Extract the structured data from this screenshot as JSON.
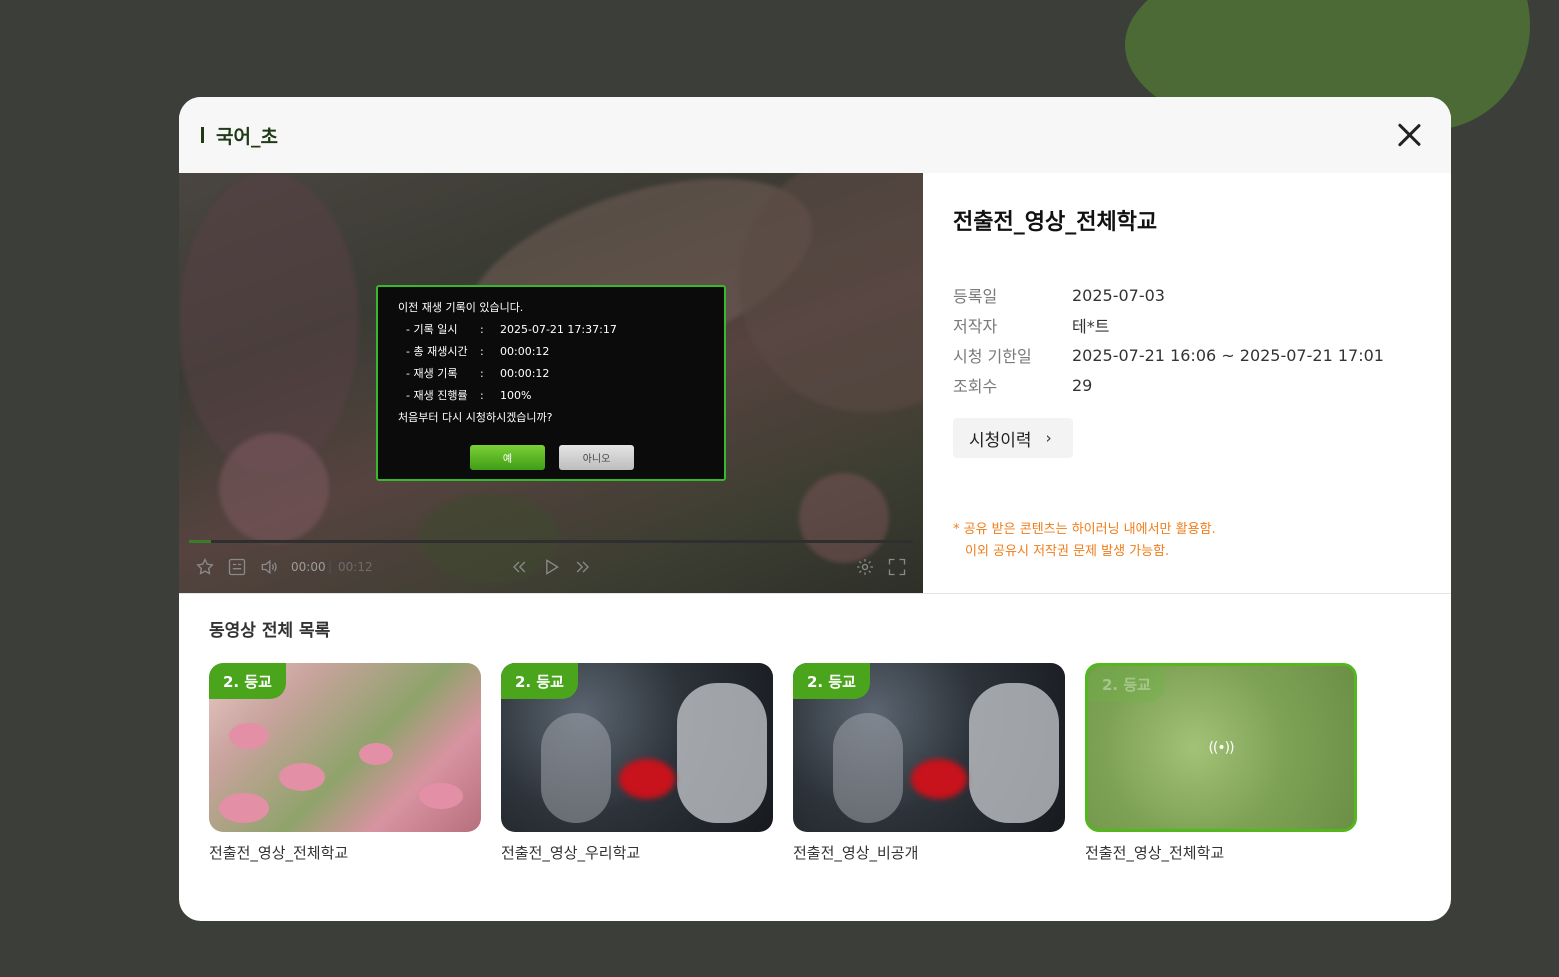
{
  "header": {
    "title": "국어_초"
  },
  "dialog": {
    "heading": "이전 재생 기록이 있습니다.",
    "rows": [
      {
        "label": "- 기록 일시",
        "value": "2025-07-21 17:37:17"
      },
      {
        "label": "- 총 재생시간",
        "value": "00:00:12"
      },
      {
        "label": "- 재생 기록",
        "value": "00:00:12"
      },
      {
        "label": "- 재생 진행률",
        "value": "100%"
      }
    ],
    "question": "처음부터 다시 시청하시겠습니까?",
    "yes_label": "예",
    "no_label": "아니오"
  },
  "player": {
    "current_time": "00:00",
    "total_time": "00:12",
    "progress": 0.03
  },
  "info": {
    "title": "전출전_영상_전체학교",
    "meta": [
      {
        "label": "등록일",
        "value": "2025-07-03"
      },
      {
        "label": "저작자",
        "value": "테*트"
      },
      {
        "label": "시청 기한일",
        "value": "2025-07-21 16:06 ~ 2025-07-21 17:01"
      },
      {
        "label": "조회수",
        "value": "29"
      }
    ],
    "history_label": "시청이력",
    "notice_line1": "* 공유 받은 콘텐츠는 하이러닝 내에서만 활용함.",
    "notice_line2": "이외 공유시 저작권 문제 발생 가능함."
  },
  "list": {
    "title": "동영상 전체 목록",
    "items": [
      {
        "badge": "2. 등교",
        "label": "전출전_영상_전체학교"
      },
      {
        "badge": "2. 등교",
        "label": "전출전_영상_우리학교"
      },
      {
        "badge": "2. 등교",
        "label": "전출전_영상_비공개"
      },
      {
        "badge": "2. 등교",
        "label": "전출전_영상_전체학교"
      }
    ]
  },
  "colors": {
    "accent": "#4aa51c",
    "dialog_border": "#39b82b",
    "notice": "#f07d1a"
  },
  "icons": [
    "close-icon",
    "star-icon",
    "subtitle-icon",
    "volume-icon",
    "rewind-icon",
    "play-icon",
    "fast-forward-icon",
    "settings-icon",
    "fullscreen-icon",
    "chevron-right-icon",
    "live-broadcast-icon"
  ]
}
